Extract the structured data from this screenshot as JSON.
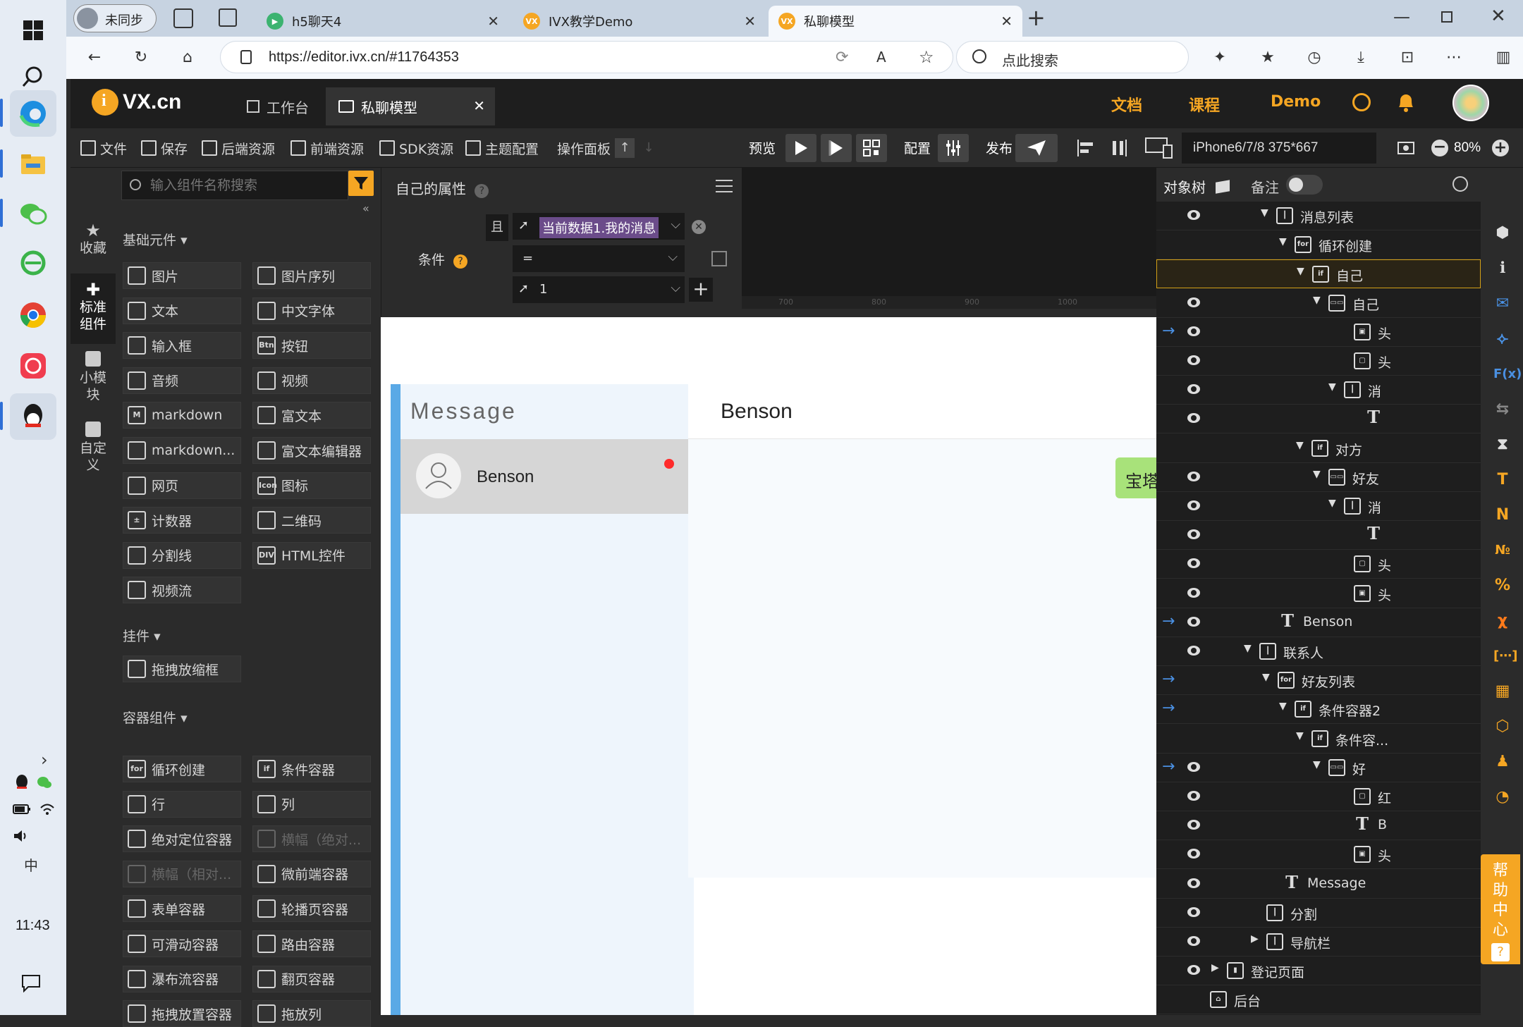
{
  "os": {
    "clock": "11:43",
    "ime": "中"
  },
  "browser": {
    "profile": "未同步",
    "tabs": [
      {
        "title": "h5聊天4"
      },
      {
        "title": "IVX教学Demo"
      },
      {
        "title": "私聊模型"
      }
    ],
    "url": "https://editor.ivx.cn/#11764353",
    "search_placeholder": "点此搜索"
  },
  "app": {
    "logo": "VX.cn",
    "tabs": [
      "工作台",
      "私聊模型"
    ],
    "links": [
      "文档",
      "课程",
      "Demo"
    ]
  },
  "toolbar": {
    "items": [
      "文件",
      "保存",
      "后端资源",
      "前端资源",
      "SDK资源",
      "主题配置",
      "操作面板"
    ],
    "preview": "预览",
    "config": "配置",
    "publish": "发布",
    "device": "iPhone6/7/8 375*667",
    "zoom": "80%"
  },
  "rail": {
    "items": [
      "收藏",
      "标准组件",
      "小模块",
      "自定义"
    ]
  },
  "components": {
    "search_placeholder": "输入组件名称搜索",
    "sections": {
      "basic": "基础元件",
      "widget": "挂件",
      "container": "容器组件"
    },
    "basic": [
      "图片",
      "图片序列",
      "文本",
      "中文字体",
      "输入框",
      "按钮",
      "音频",
      "视频",
      "markdown",
      "富文本",
      "markdown...",
      "富文本编辑器",
      "网页",
      "图标",
      "计数器",
      "二维码",
      "分割线",
      "HTML控件",
      "视频流"
    ],
    "widget": [
      "拖拽放缩框"
    ],
    "container": [
      "循环创建",
      "条件容器",
      "行",
      "列",
      "绝对定位容器",
      "横幅（绝对...",
      "横幅（相对...",
      "微前端容器",
      "表单容器",
      "轮播页容器",
      "可滑动容器",
      "路由容器",
      "瀑布流容器",
      "翻页容器",
      "拖拽放置容器",
      "拖放列"
    ]
  },
  "props": {
    "title": "自己的属性",
    "condition_label": "条件",
    "and_label": "且",
    "field1": "当前数据1.我的消息",
    "operator": "=",
    "value": "1"
  },
  "ruler": [
    "700",
    "800",
    "900",
    "1000"
  ],
  "canvas": {
    "message_header": "Message",
    "contact_name": "Benson",
    "chat_title": "Benson",
    "bubble_text": "宝塔"
  },
  "tree": {
    "title": "对象树",
    "notes": "备注",
    "rows": [
      {
        "label": "消息列表",
        "icon": "col"
      },
      {
        "label": "循环创建",
        "icon": "for"
      },
      {
        "label": "自己",
        "icon": "if"
      },
      {
        "label": "自己",
        "icon": "row"
      },
      {
        "label": "头",
        "icon": "img"
      },
      {
        "label": "头",
        "icon": "img2"
      },
      {
        "label": "消",
        "icon": "col"
      },
      {
        "label": "",
        "icon": "text"
      },
      {
        "label": "对方",
        "icon": "if"
      },
      {
        "label": "好友",
        "icon": "row"
      },
      {
        "label": "消",
        "icon": "col"
      },
      {
        "label": "",
        "icon": "text"
      },
      {
        "label": "头",
        "icon": "img2"
      },
      {
        "label": "头",
        "icon": "img"
      },
      {
        "label": "Benson",
        "icon": "text"
      },
      {
        "label": "联系人",
        "icon": "col"
      },
      {
        "label": "好友列表",
        "icon": "for"
      },
      {
        "label": "条件容器2",
        "icon": "if"
      },
      {
        "label": "条件容...",
        "icon": "if"
      },
      {
        "label": "好",
        "icon": "row"
      },
      {
        "label": "红",
        "icon": "img2"
      },
      {
        "label": "B",
        "icon": "text"
      },
      {
        "label": "头",
        "icon": "img"
      },
      {
        "label": "Message",
        "icon": "text"
      },
      {
        "label": "分割",
        "icon": "col"
      },
      {
        "label": "导航栏",
        "icon": "col"
      },
      {
        "label": "登记页面",
        "icon": "page"
      },
      {
        "label": "后台",
        "icon": "backend"
      }
    ]
  },
  "help": "帮助中心",
  "colors": {
    "accent": "#f5a623",
    "selection": "#d4a017",
    "arrow": "#4a90e2",
    "sidebar_blue": "#5aa9e6",
    "bubble": "#a8e27a",
    "notify_dot": "#ff2b2b"
  }
}
